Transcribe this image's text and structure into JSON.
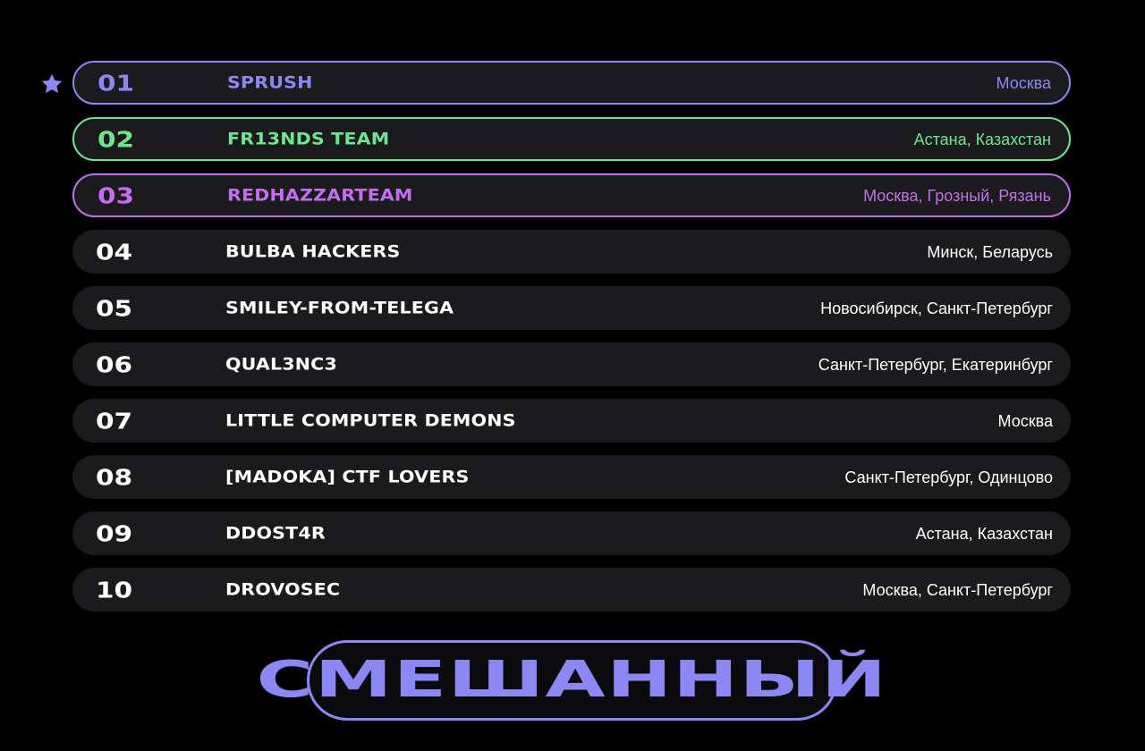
{
  "leaderboard": {
    "rows": [
      {
        "rank": "01",
        "team": "SPRUSH",
        "city": "Москва",
        "accent": "#8b88f4",
        "outlined": true,
        "starred": true
      },
      {
        "rank": "02",
        "team": "FR13NDS TEAM",
        "city": "Астана, Казахстан",
        "accent": "#6ee590",
        "outlined": true
      },
      {
        "rank": "03",
        "team": "REDHAZZARTEAM",
        "city": "Москва, Грозный, Рязань",
        "accent": "#c66cf2",
        "outlined": true
      },
      {
        "rank": "04",
        "team": "BULBA HACKERS",
        "city": "Минск, Беларусь",
        "accent": "#ffffff",
        "outlined": false
      },
      {
        "rank": "05",
        "team": "SMILEY-FROM-TELEGA",
        "city": "Новосибирск, Санкт-Петербург",
        "accent": "#ffffff",
        "outlined": false
      },
      {
        "rank": "06",
        "team": "QUAL3NC3",
        "city": "Санкт-Петербург, Екатеринбург",
        "accent": "#ffffff",
        "outlined": false
      },
      {
        "rank": "07",
        "team": "LITTLE COMPUTER DEMONS",
        "city": "Москва",
        "accent": "#ffffff",
        "outlined": false
      },
      {
        "rank": "08",
        "team": "[MADOKA] CTF LOVERS",
        "city": "Санкт-Петербург, Одинцово",
        "accent": "#ffffff",
        "outlined": false
      },
      {
        "rank": "09",
        "team": "DDOST4R",
        "city": "Астана, Казахстан",
        "accent": "#ffffff",
        "outlined": false
      },
      {
        "rank": "10",
        "team": "DROVOSEC",
        "city": "Москва, Санкт-Петербург",
        "accent": "#ffffff",
        "outlined": false
      }
    ]
  },
  "category": {
    "label": "СМЕШАННЫЙ",
    "color": "#8b88f4"
  },
  "icons": {
    "first_place": "star-icon"
  }
}
